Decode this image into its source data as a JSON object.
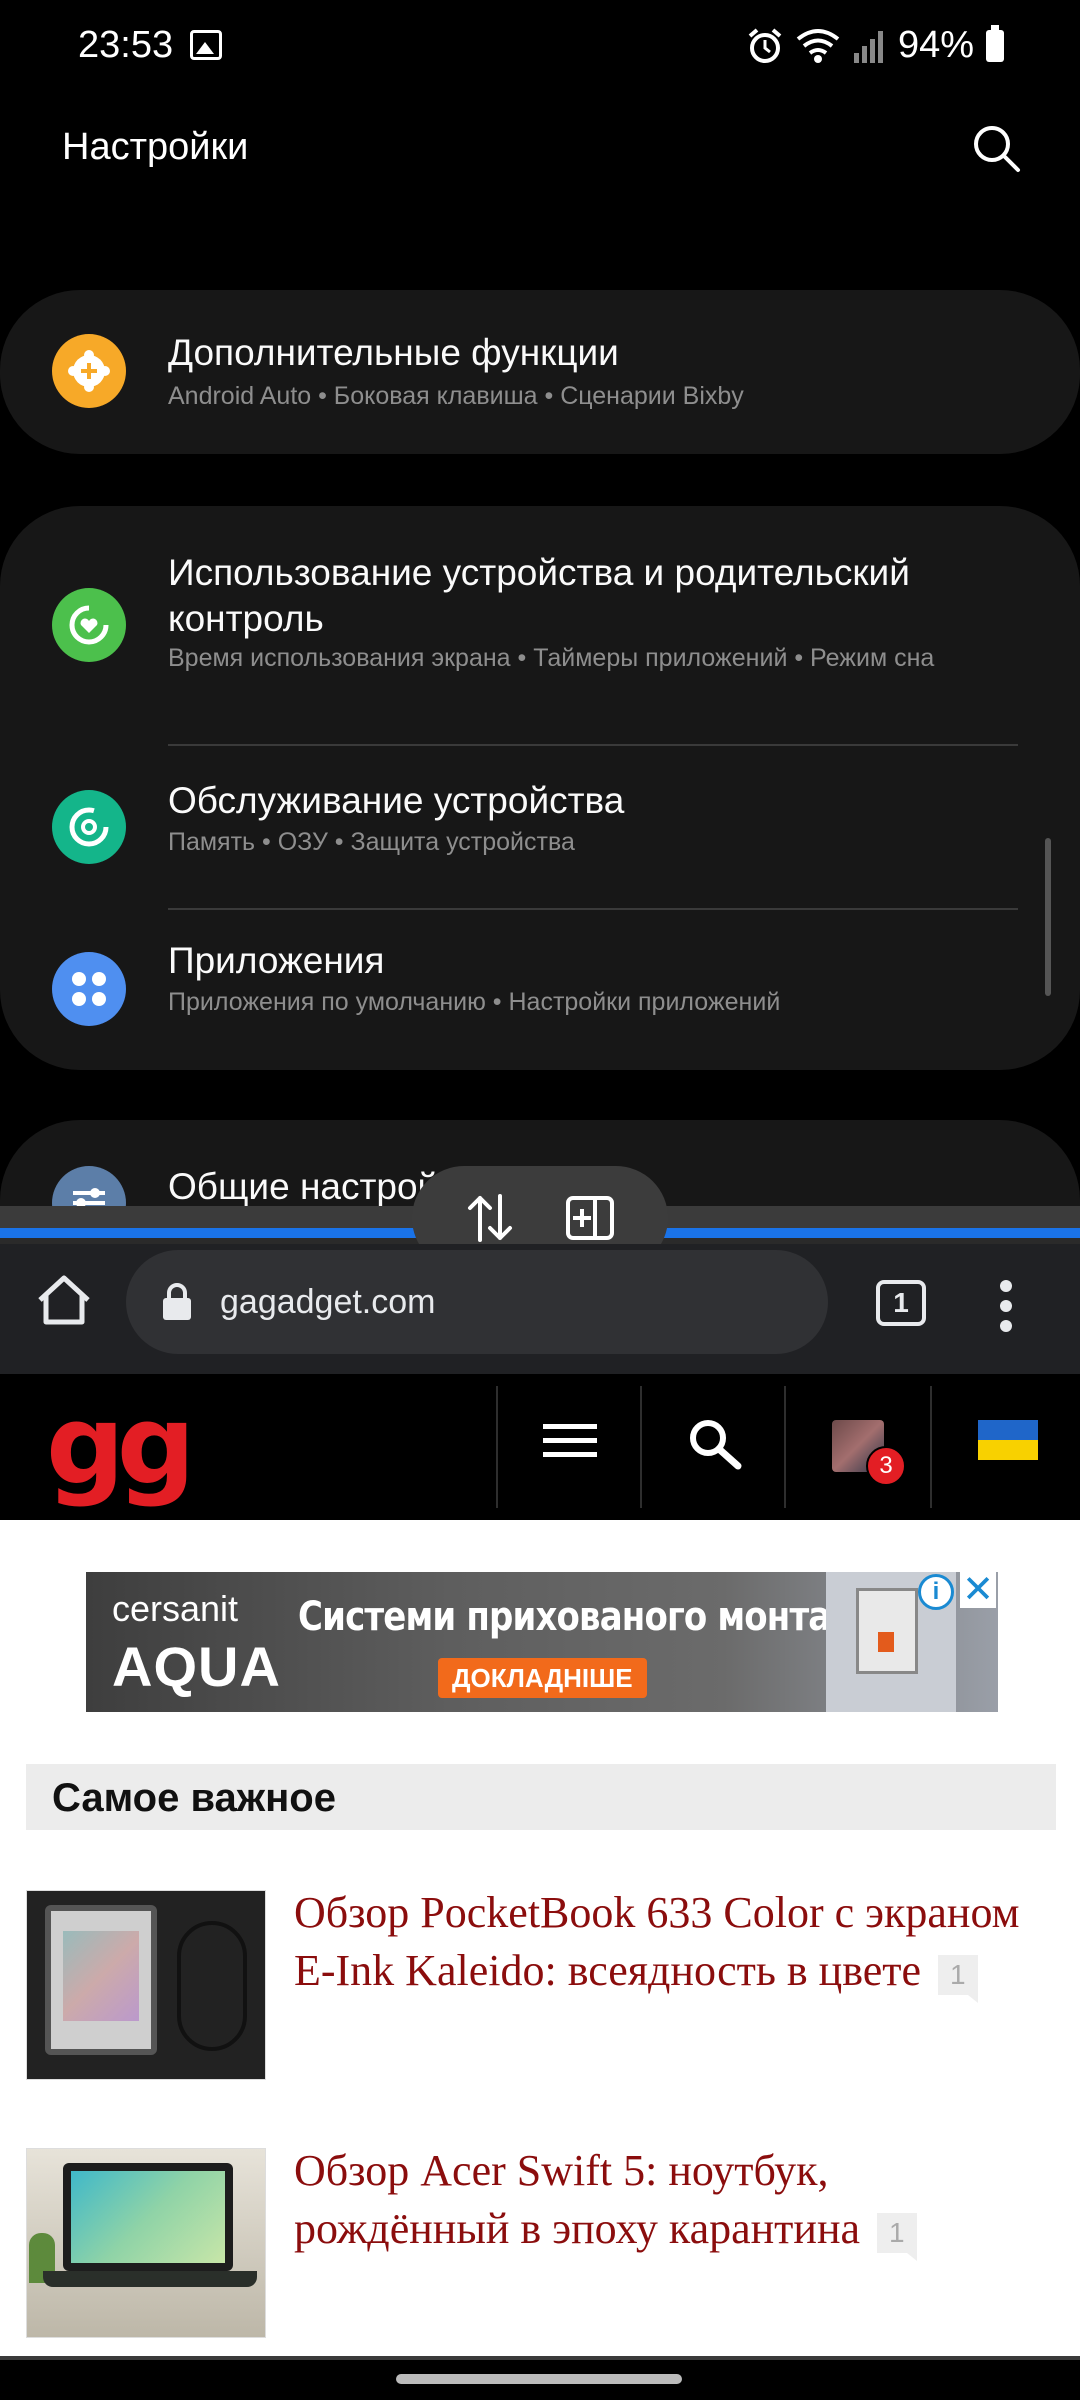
{
  "status_bar": {
    "time": "23:53",
    "battery": "94%",
    "icons": [
      "image-icon",
      "alarm-icon",
      "wifi-icon",
      "signal-icon",
      "battery-icon"
    ]
  },
  "settings": {
    "title": "Настройки",
    "items": [
      {
        "title": "Дополнительные функции",
        "subtitle": "Android Auto  •  Боковая клавиша  •  Сценарии Bixby",
        "icon": "plus-gear-icon",
        "color": "#f7a928"
      },
      {
        "title": "Использование устройства и родительский контроль",
        "subtitle": "Время использования экрана  •  Таймеры приложений  •  Режим сна",
        "icon": "digital-wellbeing-icon",
        "color": "#4cc04c"
      },
      {
        "title": "Обслуживание устройства",
        "subtitle": "Память  •  ОЗУ  •  Защита устройства",
        "icon": "device-care-icon",
        "color": "#14b58a"
      },
      {
        "title": "Приложения",
        "subtitle": "Приложения по умолчанию  •  Настройки приложений",
        "icon": "apps-icon",
        "color": "#4f8ff0"
      },
      {
        "title": "Общие настрой",
        "subtitle": "",
        "icon": "sliders-icon",
        "color": "#5c7ea8"
      }
    ]
  },
  "split_controls": {
    "swap_icon": "swap-vertical-icon",
    "pair_icon": "app-pair-icon",
    "divider_color": "#1a73e8"
  },
  "browser": {
    "url": "gagadget.com",
    "tab_count": "1"
  },
  "site": {
    "logo": "gg",
    "notification_count": "3",
    "ad": {
      "brand_line1": "cersanit",
      "brand_line2": "AQUA",
      "headline": "Системи прихованого монтажу",
      "cta": "ДОКЛАДНІШЕ"
    },
    "section_title": "Самое важное",
    "articles": [
      {
        "title": "Обзор PocketBook 633 Color с экраном E-Ink Kaleido: всеядность в цвете",
        "comments": "1"
      },
      {
        "title": "Обзор Acer Swift 5: ноутбук, рождённый в эпоху карантина",
        "comments": "1"
      }
    ]
  }
}
